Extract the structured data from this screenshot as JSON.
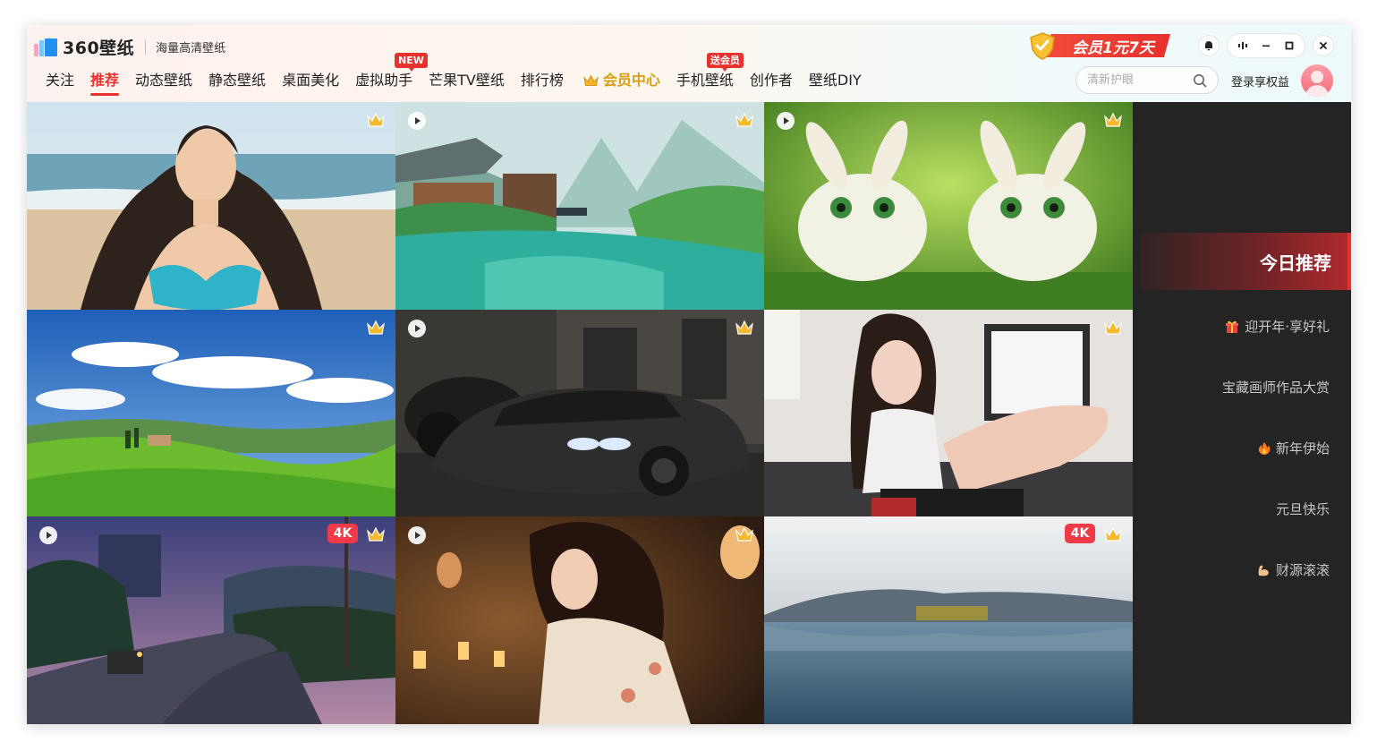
{
  "app": {
    "logo_text": "360壁纸",
    "slogan": "海量高清壁纸",
    "vip_promo": "会员1元7天"
  },
  "nav": {
    "items": [
      {
        "label": "关注"
      },
      {
        "label": "推荐",
        "active": true
      },
      {
        "label": "动态壁纸"
      },
      {
        "label": "静态壁纸"
      },
      {
        "label": "桌面美化"
      },
      {
        "label": "虚拟助手",
        "badge": "NEW"
      },
      {
        "label": "芒果TV壁纸"
      },
      {
        "label": "排行榜"
      },
      {
        "label": "会员中心",
        "icon": "crown-icon"
      },
      {
        "label": "手机壁纸",
        "badge": "送会员"
      },
      {
        "label": "创作者"
      },
      {
        "label": "壁纸DIY"
      }
    ]
  },
  "search": {
    "placeholder": "清新护眼"
  },
  "account": {
    "login_label": "登录享权益"
  },
  "tiles": [
    {
      "id": "beach-girl",
      "play": false,
      "badge_4k": false,
      "vip": true
    },
    {
      "id": "river-village",
      "play": true,
      "badge_4k": false,
      "vip": true
    },
    {
      "id": "bunnies",
      "play": true,
      "badge_4k": false,
      "vip": true
    },
    {
      "id": "hills-landscape",
      "play": false,
      "badge_4k": false,
      "vip": true
    },
    {
      "id": "black-car",
      "play": true,
      "badge_4k": false,
      "vip": true
    },
    {
      "id": "girl-window",
      "play": false,
      "badge_4k": false,
      "vip": true
    },
    {
      "id": "night-road",
      "play": true,
      "badge_4k": true,
      "vip": true
    },
    {
      "id": "lantern-girl",
      "play": true,
      "badge_4k": false,
      "vip": true
    },
    {
      "id": "lake-view",
      "play": false,
      "badge_4k": true,
      "vip": true
    }
  ],
  "badges": {
    "four_k": "4K"
  },
  "sidebar": {
    "hero": "今日推荐",
    "items": [
      {
        "label": "迎开年·享好礼",
        "icon": "gift-icon"
      },
      {
        "label": "宝藏画师作品大赏"
      },
      {
        "label": "新年伊始",
        "icon": "fire-icon"
      },
      {
        "label": "元旦快乐"
      },
      {
        "label": "财源滚滚",
        "icon": "muscle-icon"
      }
    ]
  },
  "colors": {
    "accent": "#e8322e",
    "vip_gold": "#d99c12",
    "sidebar_bg": "#242424"
  }
}
